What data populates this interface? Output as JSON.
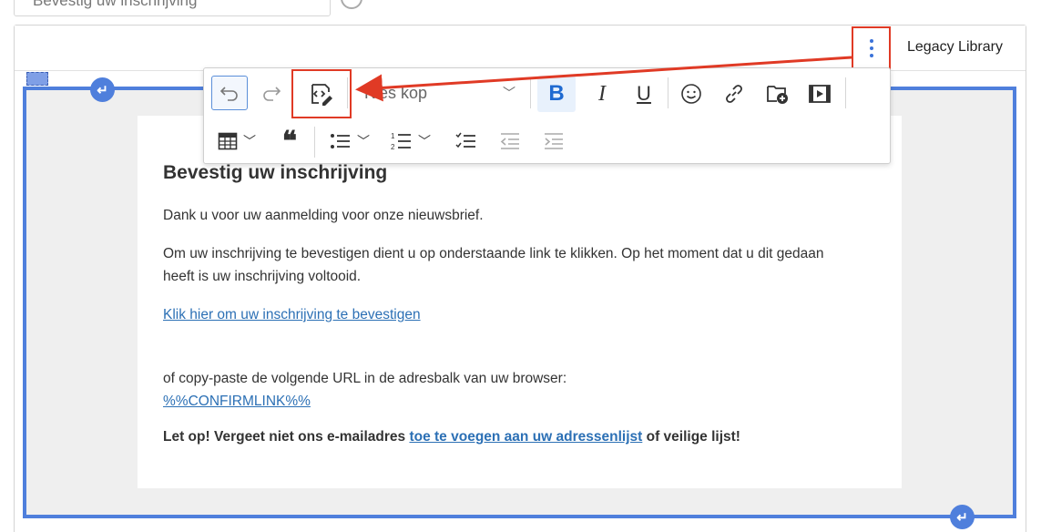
{
  "top_field": {
    "text": "Bevestig uw inschrijving"
  },
  "header": {
    "library_label": "Legacy Library",
    "more_icon": "kebab-vertical-icon"
  },
  "toolbar": {
    "heading_select": "Kies kop",
    "bold_label": "B",
    "italic_label": "I",
    "underline_label": "U",
    "quote_label": "❝",
    "chevron": "⌄"
  },
  "email": {
    "heading": "Bevestig uw inschrijving",
    "para1": "Dank u voor uw aanmelding voor onze nieuwsbrief.",
    "para2": "Om uw inschrijving te bevestigen dient u op onderstaande link te klikken. Op het moment dat u dit gedaan heeft is uw inschrijving voltooid.",
    "confirm_link": "Klik hier om uw inschrijving te bevestigen",
    "para3": "of copy-paste de volgende URL in de adresbalk van uw browser:",
    "confirm_url": "%%CONFIRMLINK%%",
    "warning_prefix": "Let op! Vergeet niet ons e-mailadres ",
    "warning_link": "toe te voegen aan uw adressenlijst",
    "warning_suffix": " of veilige lijst!"
  },
  "colors": {
    "accent": "#4f7fdc",
    "highlight": "#e03a25",
    "link": "#2c70b5"
  }
}
